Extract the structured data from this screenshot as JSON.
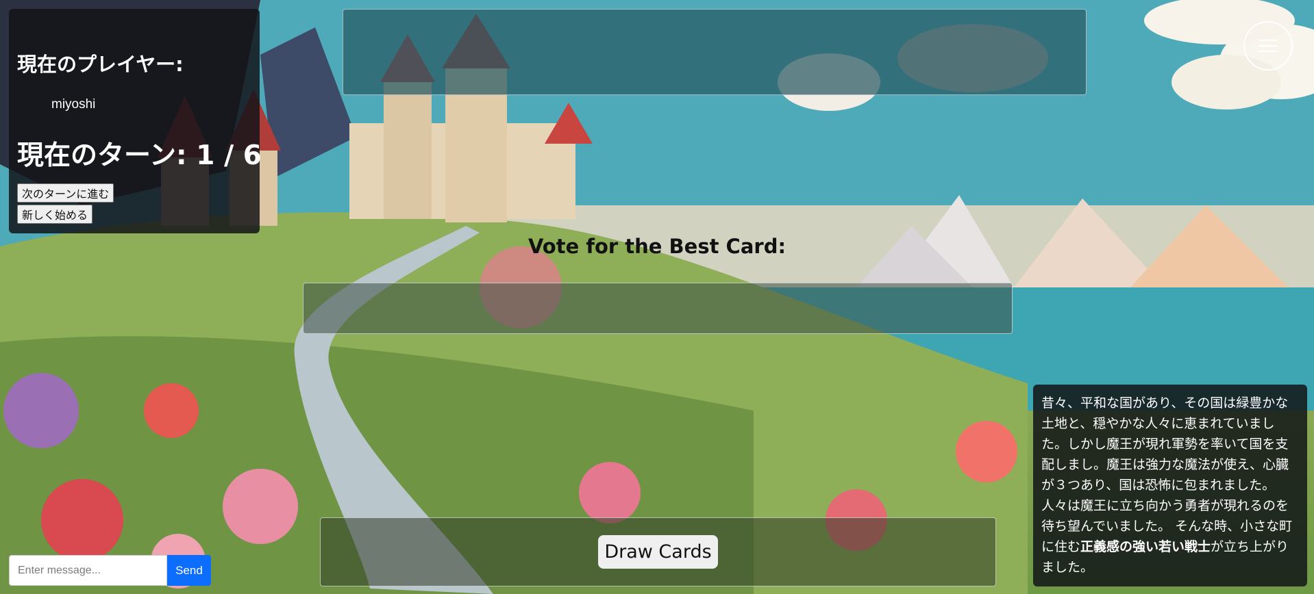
{
  "player_panel": {
    "heading": "現在のプレイヤー:",
    "player_name": "miyoshi",
    "turn_label": "現在のターン:",
    "turn_current": "1",
    "turn_separator": "/",
    "turn_total": "6",
    "next_turn_button": "次のターンに進む",
    "restart_button": "新しく始める"
  },
  "menu": {
    "icon": "hamburger-icon"
  },
  "vote": {
    "title": "Vote for the Best Card:"
  },
  "draw": {
    "button_label": "Draw Cards"
  },
  "chat": {
    "placeholder": "Enter message...",
    "value": "",
    "send_label": "Send"
  },
  "story": {
    "text_before": "昔々、平和な国があり、その国は緑豊かな土地と、穏やかな人々に恵まれていました。しかし魔王が現れ軍勢を率いて国を支配しまし。魔王は強力な魔法が使え、心臓が３つあり、国は恐怖に包まれました。人々は魔王に立ち向かう勇者が現れるのを待ち望んでいました。 そんな時、小さな町に住む",
    "text_bold": "正義感の強い若い戦士",
    "text_after": "が立ち上がりました。"
  },
  "colors": {
    "send_button": "#0d6efd",
    "panel_bg": "#141419",
    "banner_bg": "#285a64"
  }
}
